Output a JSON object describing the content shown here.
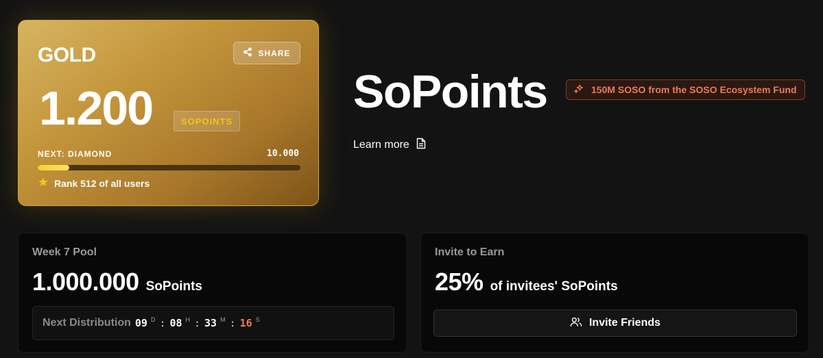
{
  "tier_card": {
    "tier": "GOLD",
    "share_label": "SHARE",
    "points": "1.200",
    "points_unit": "SOPOINTS",
    "next_label": "NEXT: DIAMOND",
    "next_threshold": "10.000",
    "progress": 0.12,
    "rank_text": "Rank 512 of all users"
  },
  "header": {
    "title": "SoPoints",
    "fund_badge": "150M SOSO from the SOSO Ecosystem Fund",
    "learn_more": "Learn more"
  },
  "pool": {
    "title": "Week 7 Pool",
    "amount": "1.000.000",
    "unit": "SoPoints",
    "next_distribution_label": "Next Distribution",
    "countdown": {
      "days": "09",
      "days_unit": "D",
      "hours": "08",
      "hours_unit": "H",
      "minutes": "33",
      "minutes_unit": "M",
      "seconds": "16",
      "seconds_unit": "S"
    }
  },
  "invite": {
    "title": "Invite to Earn",
    "percent": "25%",
    "suffix": "of invitees' SoPoints",
    "button_label": "Invite Friends"
  },
  "colors": {
    "accent_orange": "#f07a54",
    "gold_text": "#f5c21a",
    "progress_fill": "#f5d033"
  },
  "icons": [
    "share-icon",
    "star-icon",
    "sparkle-icon",
    "document-icon",
    "users-icon"
  ]
}
